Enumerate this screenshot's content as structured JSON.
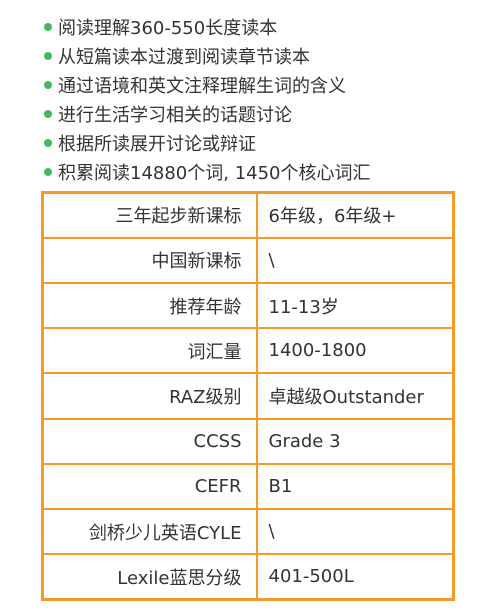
{
  "bullets": [
    "阅读理解360-550长度读本",
    "从短篇读本过渡到阅读章节读本",
    "通过语境和英文注释理解生词的含义",
    "进行生活学习相关的话题讨论",
    "根据所读展开讨论或辩证",
    "积累阅读14880个词, 1450个核心词汇"
  ],
  "table": {
    "rows": [
      {
        "key": "三年起步新课标",
        "value": "6年级，6年级+"
      },
      {
        "key": "中国新课标",
        "value": "\\"
      },
      {
        "key": "推荐年龄",
        "value": "11-13岁"
      },
      {
        "key": "词汇量",
        "value": "1400-1800"
      },
      {
        "key": "RAZ级别",
        "value": "卓越级Outstander"
      },
      {
        "key": "CCSS",
        "value": "Grade 3"
      },
      {
        "key": "CEFR",
        "value": "B1"
      },
      {
        "key": "剑桥少儿英语CYLE",
        "value": "\\"
      },
      {
        "key": "Lexile蓝思分级",
        "value": "401-500L"
      }
    ]
  },
  "colors": {
    "bullet_dot": "#3ebd5e",
    "table_border": "#f39a2b",
    "text": "#333333"
  }
}
